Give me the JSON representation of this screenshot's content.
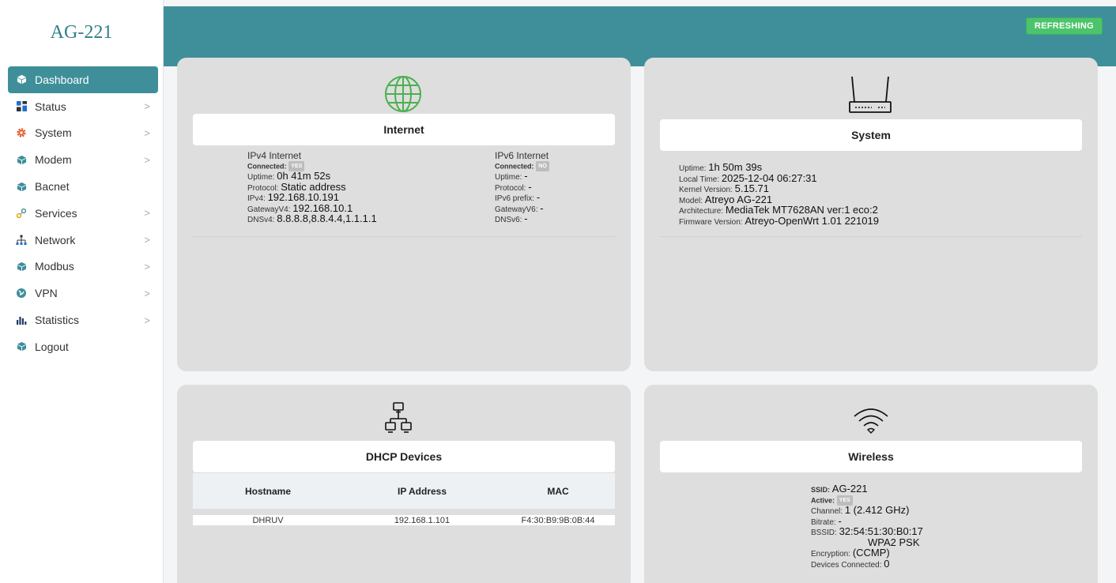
{
  "brand": "AG-221",
  "nav": [
    {
      "label": "Dashboard",
      "icon": "cube-icon",
      "active": true,
      "chevron": false
    },
    {
      "label": "Status",
      "icon": "grid-icon",
      "chevron": true
    },
    {
      "label": "System",
      "icon": "gear-icon",
      "chevron": true
    },
    {
      "label": "Modem",
      "icon": "cube-icon",
      "chevron": true
    },
    {
      "label": "Bacnet",
      "icon": "cube-icon",
      "chevron": false
    },
    {
      "label": "Services",
      "icon": "services-icon",
      "chevron": true
    },
    {
      "label": "Network",
      "icon": "network-icon",
      "chevron": true
    },
    {
      "label": "Modbus",
      "icon": "cube-icon",
      "chevron": true
    },
    {
      "label": "VPN",
      "icon": "globe-icon",
      "chevron": true
    },
    {
      "label": "Statistics",
      "icon": "bar-chart-icon",
      "chevron": true
    },
    {
      "label": "Logout",
      "icon": "cube-icon",
      "chevron": false
    }
  ],
  "header": {
    "refresh_label": "REFRESHING"
  },
  "internet": {
    "title": "Internet",
    "ipv4": {
      "heading": "IPv4 Internet",
      "connected_label": "Connected:",
      "connected": "YES",
      "uptime_label": "Uptime:",
      "uptime": "0h 41m 52s",
      "protocol_label": "Protocol:",
      "protocol": "Static address",
      "ip_label": "IPv4:",
      "ip": "192.168.10.191",
      "gateway_label": "GatewayV4:",
      "gateway": "192.168.10.1",
      "dns_label": "DNSv4:",
      "dns": "8.8.8.8,8.8.4.4,1.1.1.1"
    },
    "ipv6": {
      "heading": "IPv6 Internet",
      "connected_label": "Connected:",
      "connected": "NO",
      "uptime_label": "Uptime:",
      "uptime": "-",
      "protocol_label": "Protocol:",
      "protocol": "-",
      "prefix_label": "IPv6 prefix:",
      "prefix": "-",
      "gateway_label": "GatewayV6:",
      "gateway": "-",
      "dns_label": "DNSv6:",
      "dns": "-"
    }
  },
  "system": {
    "title": "System",
    "uptime_label": "Uptime:",
    "uptime": "1h 50m 39s",
    "localtime_label": "Local Time:",
    "localtime": "2025-12-04 06:27:31",
    "kernel_label": "Kernel Version:",
    "kernel": "5.15.71",
    "model_label": "Model:",
    "model": "Atreyo AG-221",
    "arch_label": "Architecture:",
    "arch": "MediaTek MT7628AN ver:1 eco:2",
    "firmware_label": "Firmware Version:",
    "firmware": "Atreyo-OpenWrt 1.01 221019"
  },
  "dhcp": {
    "title": "DHCP Devices",
    "columns": [
      "Hostname",
      "IP Address",
      "MAC"
    ],
    "rows": [
      {
        "hostname": "DHRUV",
        "ip": "192.168.1.101",
        "mac": "F4:30:B9:9B:0B:44"
      }
    ]
  },
  "wireless": {
    "title": "Wireless",
    "ssid_label": "SSID:",
    "ssid": "AG-221",
    "active_label": "Active:",
    "active": "YES",
    "channel_label": "Channel:",
    "channel": "1 (2.412 GHz)",
    "bitrate_label": "Bitrate:",
    "bitrate": "-",
    "bssid_label": "BSSID:",
    "bssid": "32:54:51:30:B0:17",
    "auth": "WPA2 PSK",
    "encryption_label": "Encryption:",
    "encryption": "(CCMP)",
    "devices_label": "Devices Connected:",
    "devices": "0"
  },
  "colors": {
    "teal": "#3f8f9b",
    "green": "#4cc46c",
    "card": "#dedede",
    "icon_green": "#4caf50",
    "gear_orange": "#e8541e"
  }
}
